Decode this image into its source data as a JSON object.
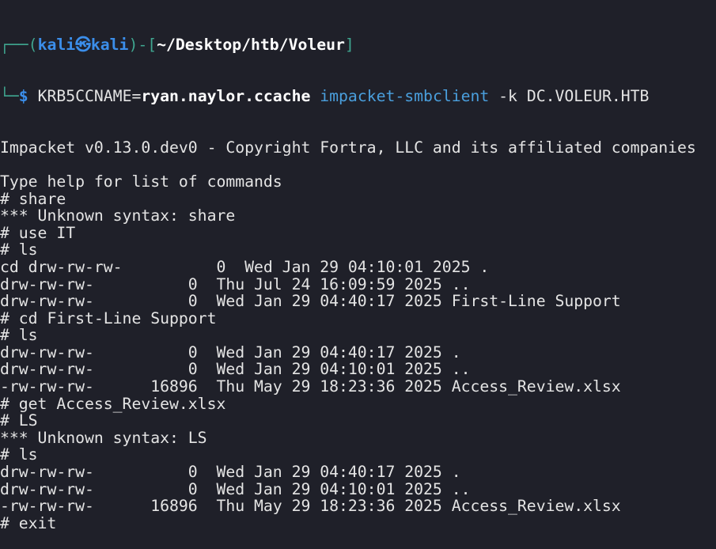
{
  "prompt": {
    "user": "kali",
    "symbol": "㉿",
    "host": "kali",
    "path": "~/Desktop/htb/Voleur",
    "env_var": "KRB5CCNAME=",
    "env_value": "ryan.naylor.ccache",
    "command": "impacket-smbclient",
    "args": " -k DC.VOLEUR.HTB"
  },
  "colors": {
    "background": "#1f2029",
    "prompt_frame": "#3fa58f",
    "prompt_user": "#3b8eea",
    "command": "#4a9fdd",
    "text": "#e4e4e4"
  },
  "output": [
    "Impacket v0.13.0.dev0 - Copyright Fortra, LLC and its affiliated companies",
    "",
    "Type help for list of commands",
    "# share",
    "*** Unknown syntax: share",
    "# use IT",
    "# ls",
    "cd drw-rw-rw-          0  Wed Jan 29 04:10:01 2025 .",
    "drw-rw-rw-          0  Thu Jul 24 16:09:59 2025 ..",
    "drw-rw-rw-          0  Wed Jan 29 04:40:17 2025 First-Line Support",
    "# cd First-Line Support",
    "# ls",
    "drw-rw-rw-          0  Wed Jan 29 04:40:17 2025 .",
    "drw-rw-rw-          0  Wed Jan 29 04:10:01 2025 ..",
    "-rw-rw-rw-      16896  Thu May 29 18:23:36 2025 Access_Review.xlsx",
    "# get Access_Review.xlsx",
    "# LS",
    "*** Unknown syntax: LS",
    "# ls",
    "drw-rw-rw-          0  Wed Jan 29 04:40:17 2025 .",
    "drw-rw-rw-          0  Wed Jan 29 04:10:01 2025 ..",
    "-rw-rw-rw-      16896  Thu May 29 18:23:36 2025 Access_Review.xlsx",
    "# exit"
  ]
}
